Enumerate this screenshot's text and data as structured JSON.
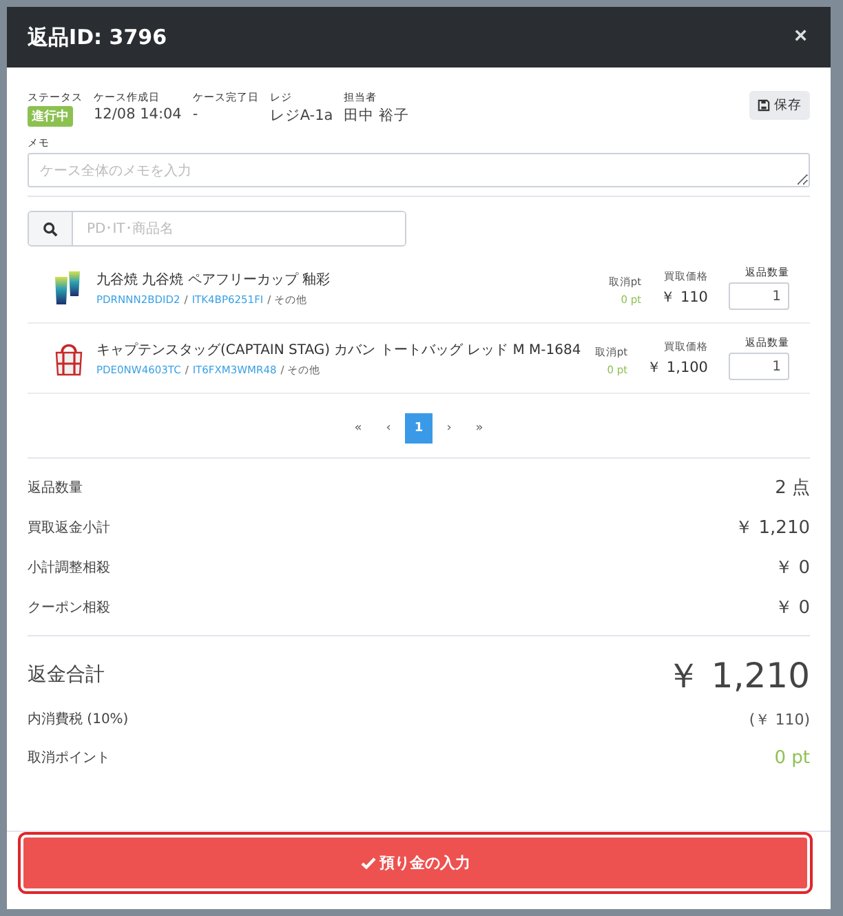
{
  "modal": {
    "title": "返品ID: 3796",
    "close": "×"
  },
  "info": [
    {
      "label": "ステータス",
      "value": "進行中",
      "kind": "badge"
    },
    {
      "label": "ケース作成日",
      "value": "12/08 14:04",
      "kind": "text"
    },
    {
      "label": "ケース完了日",
      "value": "-",
      "kind": "text"
    },
    {
      "label": "レジ",
      "value": "レジA-1a",
      "kind": "text"
    },
    {
      "label": "担当者",
      "value": "田中 裕子",
      "kind": "text"
    }
  ],
  "save_button": "保存",
  "memo": {
    "label": "メモ",
    "placeholder": "ケース全体のメモを入力"
  },
  "search": {
    "placeholder": "PD･IT･商品名"
  },
  "items": [
    {
      "name": "九谷焼 九谷焼 ペアフリーカップ 釉彩",
      "pd": "PDRNNN2BDID2",
      "separator": "/",
      "it": "ITK4BP6251FI",
      "category": "/ その他",
      "kind": "cups",
      "points_label": "取消pt",
      "points": "0 pt",
      "price_label": "買取価格",
      "price": "￥ 110",
      "qty_label": "返品数量",
      "qty": "1"
    },
    {
      "name": "キャプテンスタッグ(CAPTAIN STAG) カバン トートバッグ レッド M M-1684",
      "pd": "PDE0NW4603TC",
      "separator": "/",
      "it": "IT6FXM3WMR48",
      "category": "/ その他",
      "kind": "bag",
      "points_label": "取消pt",
      "points": "0 pt",
      "price_label": "買取価格",
      "price": "￥ 1,100",
      "qty_label": "返品数量",
      "qty": "1"
    }
  ],
  "pagination": [
    {
      "label": "«",
      "selected": false
    },
    {
      "label": "‹",
      "selected": false
    },
    {
      "label": "1",
      "selected": true
    },
    {
      "label": "›",
      "selected": false
    },
    {
      "label": "»",
      "selected": false
    }
  ],
  "summary": [
    {
      "label": "返品数量",
      "value": "2 点"
    },
    {
      "label": "買取返金小計",
      "value": "￥ 1,210"
    },
    {
      "label": "小計調整相殺",
      "value": "￥ 0"
    },
    {
      "label": "クーポン相殺",
      "value": "￥ 0"
    }
  ],
  "total": {
    "label": "返金合計",
    "value": "￥ 1,210"
  },
  "details": [
    {
      "label": "内消費税 (10%)",
      "value": "(￥ 110)",
      "kind": "tax"
    },
    {
      "label": "取消ポイント",
      "value": "0 pt",
      "kind": "points"
    }
  ],
  "submit_button": "預り金の入力"
}
